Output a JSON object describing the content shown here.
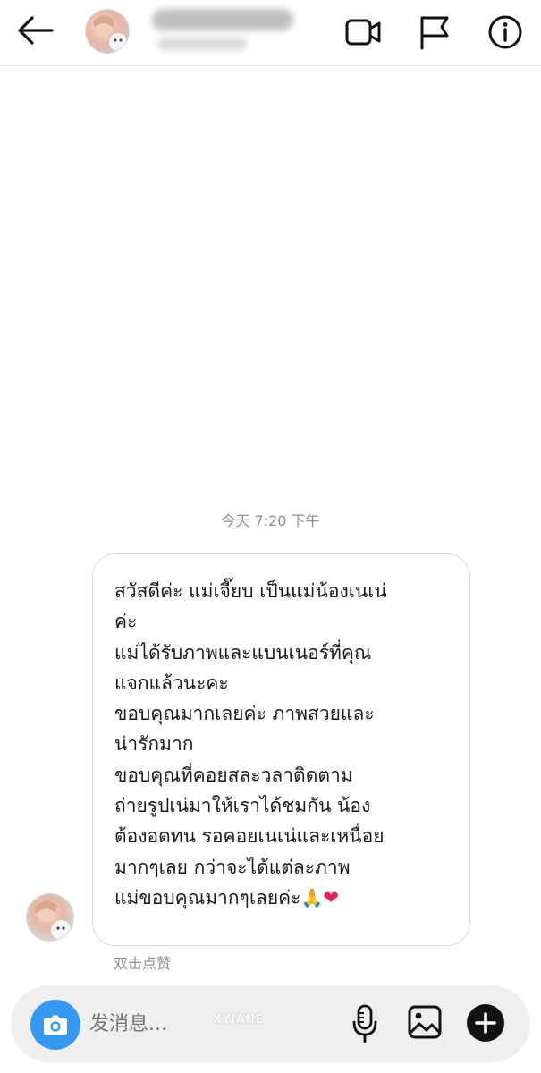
{
  "header": {
    "back_icon": "arrow-left-icon",
    "video_icon": "video-camera-icon",
    "report_icon": "flag-icon",
    "info_icon": "info-icon"
  },
  "chat": {
    "timestamp": "今天 7:20 下午",
    "message_lines": [
      "สวัสดีค่ะ แม่เจี๊ยบ เป็นแม่น้องเนเน่",
      "ค่ะ",
      "แม่ได้รับภาพและแบนเนอร์ที่คุณ",
      "แจกแล้วนะคะ",
      "ขอบคุณมากเลยค่ะ ภาพสวยและ",
      "น่ารักมาก",
      "ขอบคุณที่คอยสละวลาติดตาม",
      "ถ่ายรูปเน่มาให้เราได้ชมกัน น้อง",
      "ต้องอดทน รอคอยเนเน่และเหนื่อย",
      "มากๆเลย กว่าจะได้แต่ละภาพ",
      "แม่ขอบคุณมากๆเลยค่ะ"
    ],
    "emoji_pray": "🙏",
    "emoji_heart": "❤",
    "double_tap_hint": "双击点赞"
  },
  "composer": {
    "placeholder": "发消息...",
    "watermark": "XYJANE",
    "camera_icon": "camera-icon",
    "mic_icon": "microphone-icon",
    "gallery_icon": "image-icon",
    "add_icon": "plus-circle-icon",
    "accent_color": "#3897f0"
  }
}
